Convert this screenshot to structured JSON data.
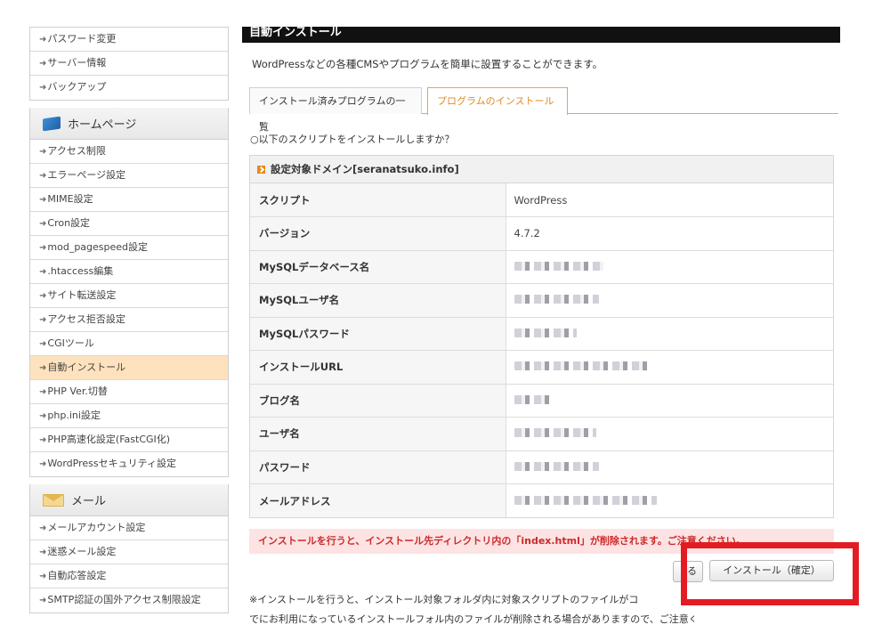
{
  "sidebar": {
    "top_items": [
      "パスワード変更",
      "サーバー情報",
      "バックアップ"
    ],
    "homepage_header": "ホームページ",
    "homepage_items": [
      "アクセス制限",
      "エラーページ設定",
      "MIME設定",
      "Cron設定",
      "mod_pagespeed設定",
      ".htaccess編集",
      "サイト転送設定",
      "アクセス拒否設定",
      "CGIツール",
      "自動インストール",
      "PHP Ver.切替",
      "php.ini設定",
      "PHP高速化設定(FastCGI化)",
      "WordPressセキュリティ設定"
    ],
    "active_item": "自動インストール",
    "mail_header": "メール",
    "mail_items": [
      "メールアカウント設定",
      "迷惑メール設定",
      "自動応答設定",
      "SMTP認証の国外アクセス制限設定"
    ]
  },
  "main": {
    "title": "自動インストール",
    "description": "WordPressなどの各種CMSやプログラムを簡単に設置することができます。",
    "tabs": [
      {
        "label": "インストール済みプログラムの一覧",
        "active": false
      },
      {
        "label": "プログラムのインストール",
        "active": true
      }
    ],
    "question": "○以下のスクリプトをインストールしますか？",
    "domain_heading": "設定対象ドメイン[seranatsuko.info]",
    "rows": [
      {
        "label": "スクリプト",
        "value": "WordPress"
      },
      {
        "label": "バージョン",
        "value": "4.7.2"
      },
      {
        "label": "MySQLデータベース名",
        "value": ""
      },
      {
        "label": "MySQLユーザ名",
        "value": ""
      },
      {
        "label": "MySQLパスワード",
        "value": ""
      },
      {
        "label": "インストールURL",
        "value": ""
      },
      {
        "label": "ブログ名",
        "value": ""
      },
      {
        "label": "ユーザ名",
        "value": ""
      },
      {
        "label": "パスワード",
        "value": ""
      },
      {
        "label": "メールアドレス",
        "value": ""
      }
    ],
    "warning": "インストールを行うと、インストール先ディレクトリ内の「index.html」が削除されます。ご注意ください。",
    "back_label": "る",
    "install_label": "インストール（確定）",
    "note_line1": "※インストールを行うと、インストール対象フォルダ内に対象スクリプトのファイルがコ",
    "note_line2": "でにお利用になっているインストールフォル内のファイルが削除される場合がありますので、ご注意ください。"
  },
  "colors": {
    "title_bar": "#111111",
    "tab_accent": "#e08a25",
    "active_sidebar": "#fde2bd",
    "warning_text": "#cc2a2a",
    "warning_bg": "#fde3e3",
    "highlight_border": "#e31b23"
  },
  "icons": {
    "sidebar_arrow": "arrow-right-icon",
    "homepage": "book-icon",
    "mail": "mail-envelope-icon",
    "domain_heading": "orange-square-icon"
  }
}
